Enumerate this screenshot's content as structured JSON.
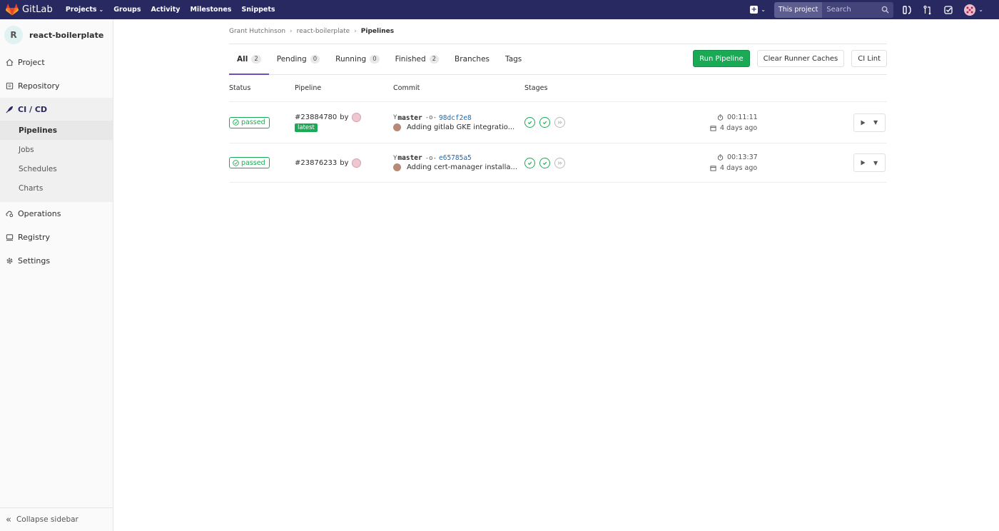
{
  "topbar": {
    "logo_text": "GitLab",
    "nav": [
      {
        "label": "Projects",
        "has_dropdown": true
      },
      {
        "label": "Groups"
      },
      {
        "label": "Activity"
      },
      {
        "label": "Milestones"
      },
      {
        "label": "Snippets"
      }
    ],
    "search_scope": "This project",
    "search_placeholder": "Search",
    "brand_color": "#292961"
  },
  "sidebar": {
    "project_initial": "R",
    "project_name": "react-boilerplate",
    "items": [
      {
        "label": "Project",
        "icon": "home-icon"
      },
      {
        "label": "Repository",
        "icon": "book-icon"
      },
      {
        "label": "CI / CD",
        "icon": "rocket-icon",
        "active": true
      },
      {
        "label": "Operations",
        "icon": "cloud-gear-icon"
      },
      {
        "label": "Registry",
        "icon": "monitor-icon"
      },
      {
        "label": "Settings",
        "icon": "gear-icon"
      }
    ],
    "cicd_sub": [
      {
        "label": "Pipelines",
        "active": true
      },
      {
        "label": "Jobs"
      },
      {
        "label": "Schedules"
      },
      {
        "label": "Charts"
      }
    ],
    "collapse_label": "Collapse sidebar"
  },
  "breadcrumb": {
    "items": [
      "Grant Hutchinson",
      "react-boilerplate"
    ],
    "current": "Pipelines"
  },
  "tabs": [
    {
      "label": "All",
      "count": "2",
      "active": true
    },
    {
      "label": "Pending",
      "count": "0"
    },
    {
      "label": "Running",
      "count": "0"
    },
    {
      "label": "Finished",
      "count": "2"
    },
    {
      "label": "Branches"
    },
    {
      "label": "Tags"
    }
  ],
  "actions": {
    "run_pipeline": "Run Pipeline",
    "clear_caches": "Clear Runner Caches",
    "ci_lint": "CI Lint"
  },
  "table": {
    "headers": {
      "status": "Status",
      "pipeline": "Pipeline",
      "commit": "Commit",
      "stages": "Stages"
    },
    "rows": [
      {
        "status": "passed",
        "pipeline_id": "#23884780",
        "by": "by",
        "latest_label": "latest",
        "branch": "master",
        "sha": "98dcf2e8",
        "message": "Adding gitlab GKE integratio...",
        "duration": "00:11:11",
        "finished": "4 days ago"
      },
      {
        "status": "passed",
        "pipeline_id": "#23876233",
        "by": "by",
        "branch": "master",
        "sha": "e65785a5",
        "message": "Adding cert-manager installa...",
        "duration": "00:13:37",
        "finished": "4 days ago"
      }
    ]
  },
  "colors": {
    "success": "#1aaa55",
    "link": "#1b69b6",
    "active_tab": "#6b4fbb"
  }
}
